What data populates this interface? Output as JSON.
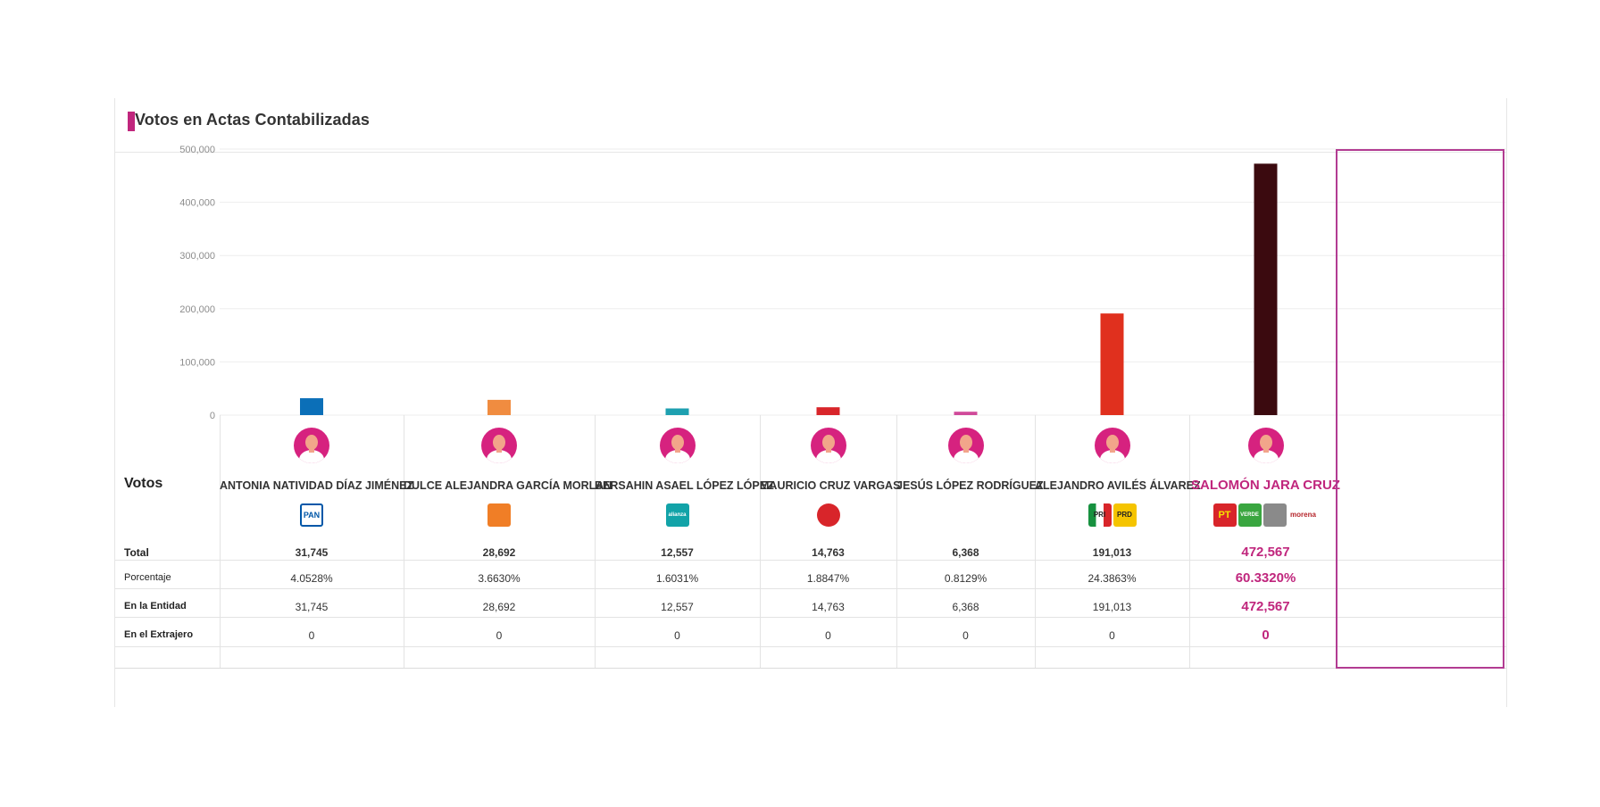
{
  "panel": {
    "title": "Votos en Actas Contabilizadas"
  },
  "table": {
    "votos_label": "Votos",
    "row_labels": [
      "Total",
      "Porcentaje",
      "En la Entidad",
      "En el Extrajero"
    ]
  },
  "colors": {
    "accent": "#c0267d",
    "highlight_border": "#b23c92"
  },
  "chart_data": {
    "type": "bar",
    "title": "",
    "xlabel": "",
    "ylabel": "",
    "ylim": [
      0,
      500000
    ],
    "yticks": [
      0,
      100000,
      200000,
      300000,
      400000,
      500000
    ],
    "ytick_labels": [
      "0",
      "100,000",
      "200,000",
      "300,000",
      "400,000",
      "500,000"
    ],
    "grid": true,
    "categories": [
      "ANTONIA NATIVIDAD DÍAZ JIMÉNEZ",
      "DULCE ALEJANDRA GARCÍA MORLAN",
      "BERSAHIN ASAEL LÓPEZ LÓPEZ",
      "MAURICIO CRUZ VARGAS",
      "JESÚS LÓPEZ RODRÍGUEZ",
      "ALEJANDRO AVILÉS ÁLVAREZ",
      "SALOMÓN JARA CRUZ"
    ],
    "values": [
      31745,
      28692,
      12557,
      14763,
      6368,
      191013,
      472567
    ],
    "bar_colors": [
      "#0b6fb8",
      "#f08c40",
      "#1ea0b0",
      "#d8252a",
      "#d04a9a",
      "#e0301e",
      "#3b0a0f"
    ]
  },
  "candidates": [
    {
      "name": "ANTONIA NATIVIDAD DÍAZ JIMÉNEZ",
      "total": "31,745",
      "porcentaje": "4.0528%",
      "entidad": "31,745",
      "extranjero": "0",
      "logos": [
        {
          "icon": "pan-logo",
          "text": "PAN",
          "color": "#0057a8"
        }
      ]
    },
    {
      "name": "DULCE ALEJANDRA GARCÍA MORLAN",
      "total": "28,692",
      "porcentaje": "3.6630%",
      "entidad": "28,692",
      "extranjero": "0",
      "logos": [
        {
          "icon": "movimiento-ciudadano-logo",
          "text": "",
          "color": "#f07e26"
        }
      ]
    },
    {
      "name": "BERSAHIN ASAEL LÓPEZ LÓPEZ",
      "total": "12,557",
      "porcentaje": "1.6031%",
      "entidad": "12,557",
      "extranjero": "0",
      "logos": [
        {
          "icon": "nueva-alianza-logo",
          "text": "alianza",
          "color": "#12a3a8"
        }
      ]
    },
    {
      "name": "MAURICIO CRUZ VARGAS",
      "total": "14,763",
      "porcentaje": "1.8847%",
      "entidad": "14,763",
      "extranjero": "0",
      "logos": [
        {
          "icon": "red-party-logo",
          "text": "",
          "color": "#d8252a"
        }
      ]
    },
    {
      "name": "JESÚS LÓPEZ RODRÍGUEZ",
      "total": "6,368",
      "porcentaje": "0.8129%",
      "entidad": "6,368",
      "extranjero": "0",
      "logos": [
        {
          "icon": "tree-party-logo",
          "text": "",
          "color": "#5aa63c"
        }
      ]
    },
    {
      "name": "ALEJANDRO AVILÉS ÁLVAREZ",
      "total": "191,013",
      "porcentaje": "24.3863%",
      "entidad": "191,013",
      "extranjero": "0",
      "logos": [
        {
          "icon": "pri-logo",
          "text": "PRI",
          "color": "#17913f"
        },
        {
          "icon": "prd-logo",
          "text": "PRD",
          "color": "#f5c400"
        }
      ]
    },
    {
      "name": "SALOMÓN JARA CRUZ",
      "total": "472,567",
      "porcentaje": "60.3320%",
      "entidad": "472,567",
      "extranjero": "0",
      "winner": true,
      "logos": [
        {
          "icon": "pt-logo",
          "text": "PT",
          "color": "#d8252a"
        },
        {
          "icon": "verde-logo",
          "text": "VERDE",
          "color": "#3aa640"
        },
        {
          "icon": "unidad-popular-logo",
          "text": "",
          "color": "#8a8a8a"
        },
        {
          "icon": "morena-logo",
          "text": "morena",
          "color": "#b5252b"
        }
      ]
    }
  ]
}
